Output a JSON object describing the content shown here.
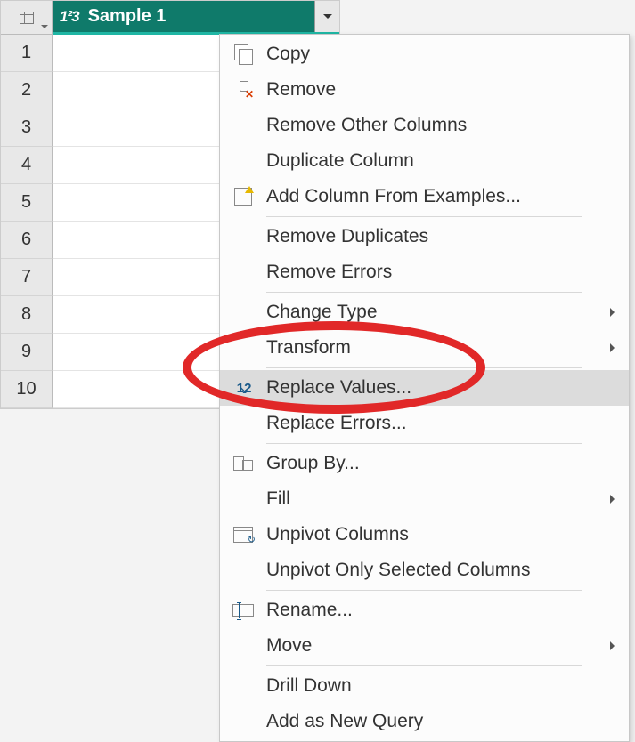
{
  "table": {
    "column": {
      "type_label": "1²3",
      "name": "Sample 1"
    },
    "row_numbers": [
      "1",
      "2",
      "3",
      "4",
      "5",
      "6",
      "7",
      "8",
      "9",
      "10"
    ]
  },
  "context_menu": {
    "groups": [
      {
        "items": [
          {
            "label": "Copy",
            "icon": "copy-icon",
            "submenu": false
          },
          {
            "label": "Remove",
            "icon": "remove-icon",
            "submenu": false
          },
          {
            "label": "Remove Other Columns",
            "icon": null,
            "submenu": false
          },
          {
            "label": "Duplicate Column",
            "icon": null,
            "submenu": false
          },
          {
            "label": "Add Column From Examples...",
            "icon": "add-column-icon",
            "submenu": false
          }
        ]
      },
      {
        "items": [
          {
            "label": "Remove Duplicates",
            "icon": null,
            "submenu": false
          },
          {
            "label": "Remove Errors",
            "icon": null,
            "submenu": false
          }
        ]
      },
      {
        "items": [
          {
            "label": "Change Type",
            "icon": null,
            "submenu": true
          },
          {
            "label": "Transform",
            "icon": null,
            "submenu": true
          }
        ]
      },
      {
        "items": [
          {
            "label": "Replace Values...",
            "icon": "replace-values-icon",
            "submenu": false,
            "highlighted": true
          },
          {
            "label": "Replace Errors...",
            "icon": null,
            "submenu": false
          }
        ]
      },
      {
        "items": [
          {
            "label": "Group By...",
            "icon": "group-by-icon",
            "submenu": false
          },
          {
            "label": "Fill",
            "icon": null,
            "submenu": true
          },
          {
            "label": "Unpivot Columns",
            "icon": "unpivot-icon",
            "submenu": false
          },
          {
            "label": "Unpivot Only Selected Columns",
            "icon": null,
            "submenu": false
          }
        ]
      },
      {
        "items": [
          {
            "label": "Rename...",
            "icon": "rename-icon",
            "submenu": false
          },
          {
            "label": "Move",
            "icon": null,
            "submenu": true
          }
        ]
      },
      {
        "items": [
          {
            "label": "Drill Down",
            "icon": null,
            "submenu": false
          },
          {
            "label": "Add as New Query",
            "icon": null,
            "submenu": false
          }
        ]
      }
    ]
  },
  "annotation": {
    "highlighted_label": "Replace Values..."
  }
}
